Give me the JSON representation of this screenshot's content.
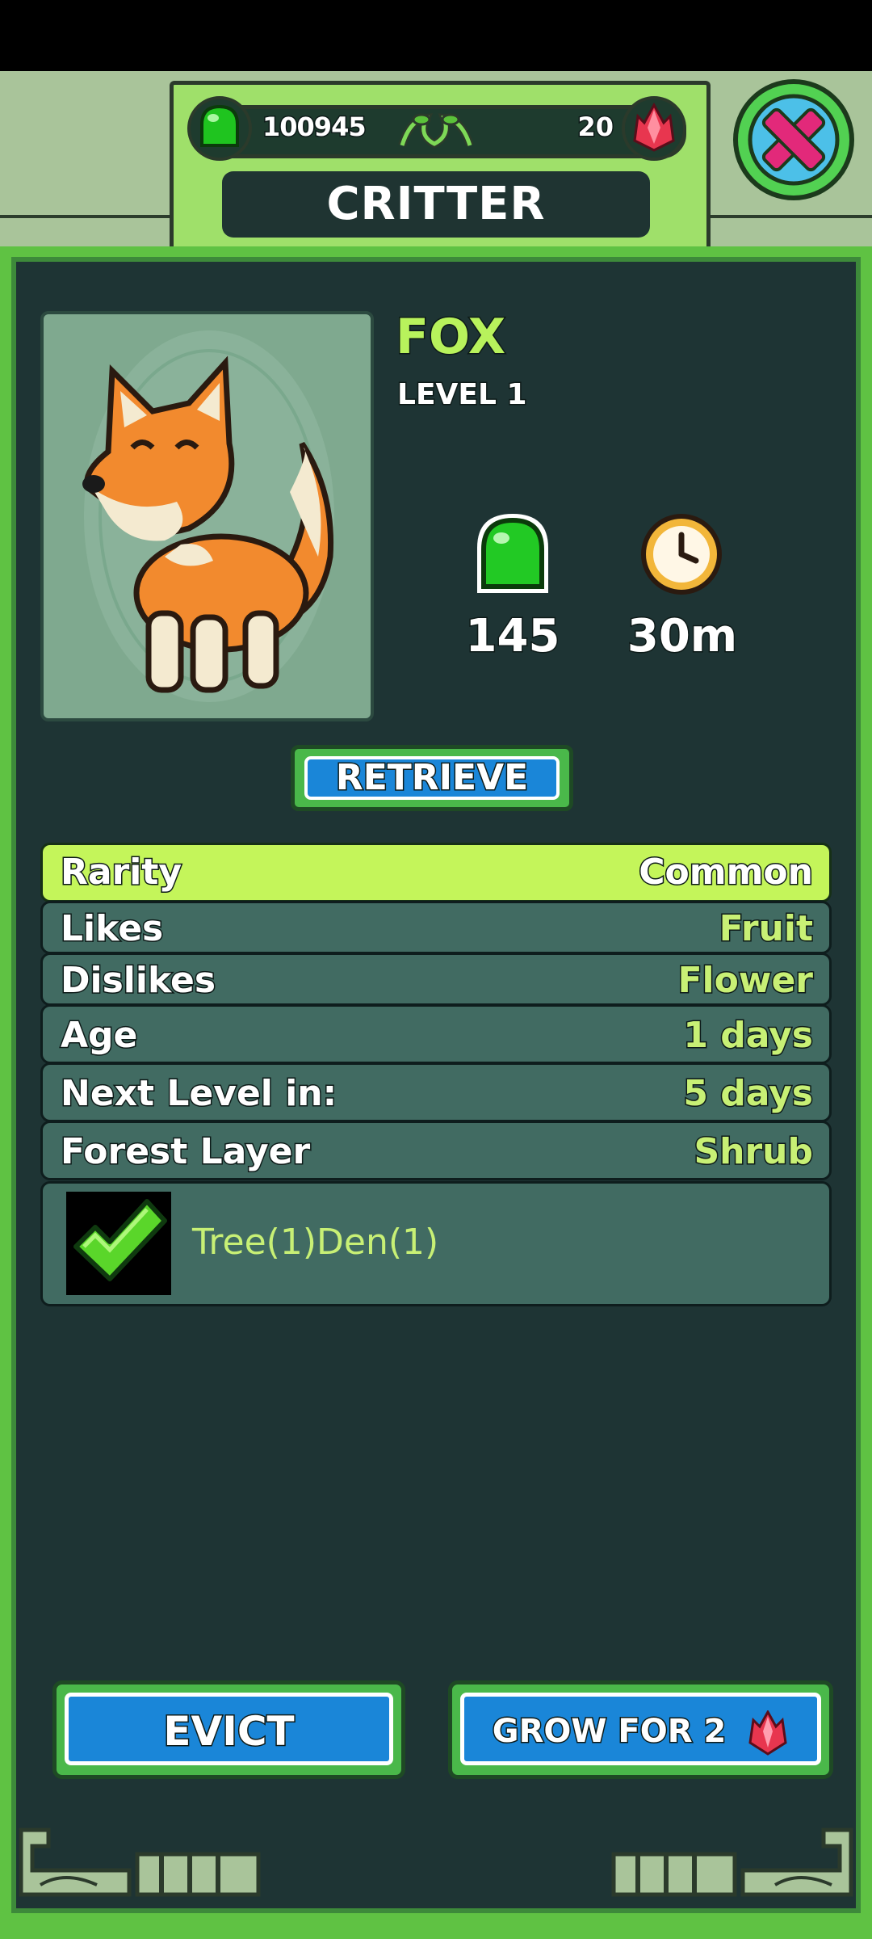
{
  "header": {
    "title": "CRITTER",
    "gel_currency": "100945",
    "gem_currency": "20",
    "close_icon": "close-x-icon"
  },
  "critter": {
    "name": "FOX",
    "level": "LEVEL 1",
    "portrait_icon": "fox-portrait",
    "gel_yield": "145",
    "time": "30m"
  },
  "retrieve_label": "RETRIEVE",
  "stats": [
    {
      "label": "Rarity",
      "value": "Common"
    },
    {
      "label": "Likes",
      "value": "Fruit"
    },
    {
      "label": "Dislikes",
      "value": "Flower"
    },
    {
      "label": "Age",
      "value": "1 days"
    },
    {
      "label": "Next Level in:",
      "value": "5 days"
    },
    {
      "label": "Forest Layer",
      "value": "Shrub"
    }
  ],
  "habitat": {
    "requirements": "Tree(1)Den(1)",
    "status_icon": "checkmark-icon"
  },
  "buttons": {
    "evict": "EVICT",
    "grow": "GROW FOR 2"
  },
  "colors": {
    "accent_green": "#b8f25c",
    "button_blue": "#1a86d8",
    "panel_dark": "#1e3434",
    "rarity_highlight": "#c4f55a"
  }
}
